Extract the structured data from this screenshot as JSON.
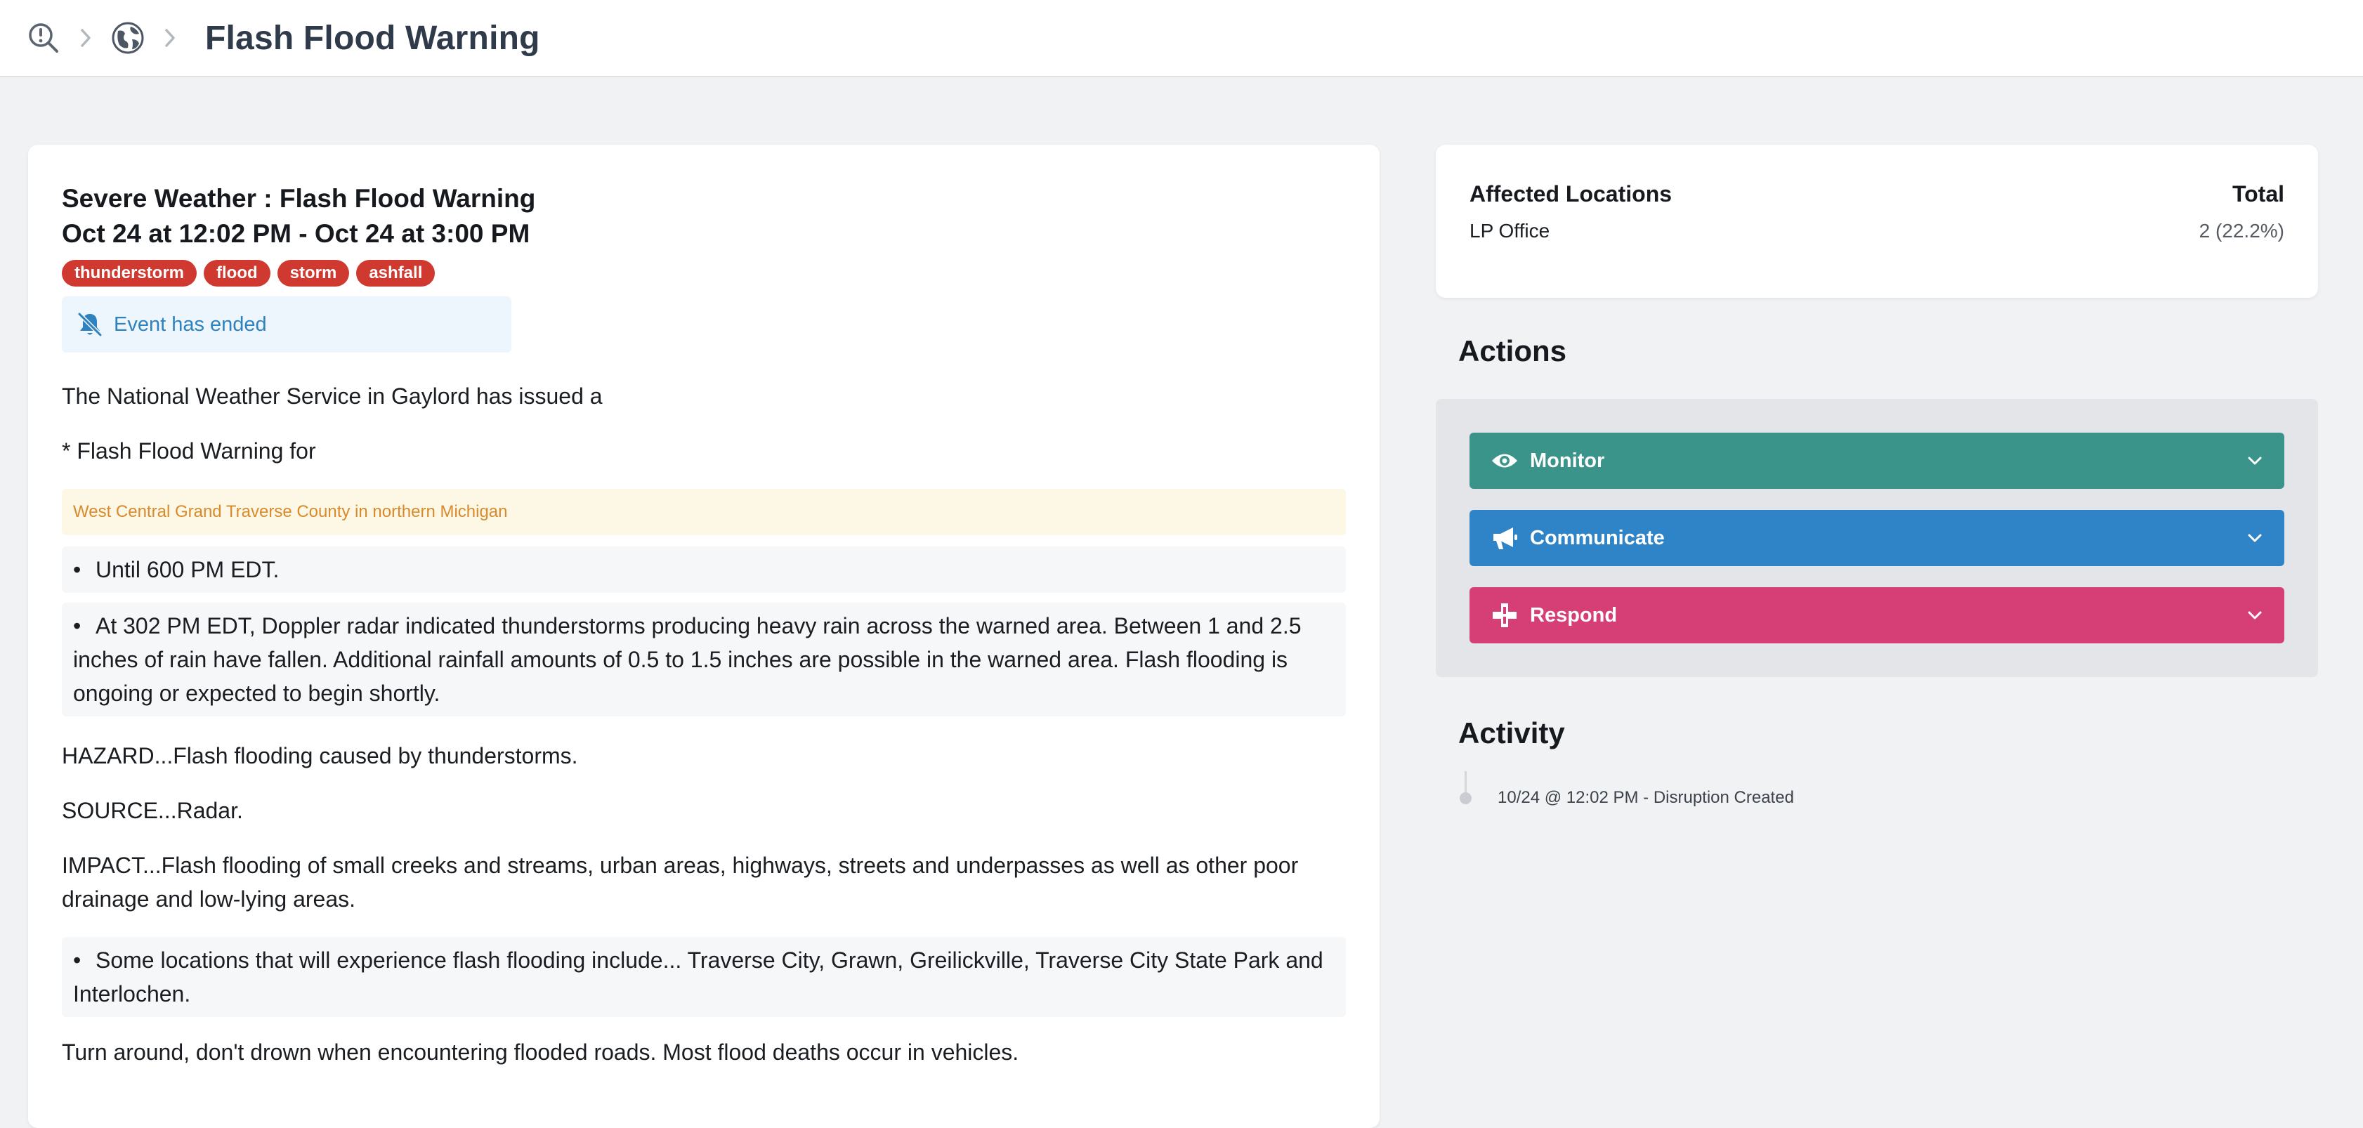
{
  "header": {
    "breadcrumb_icons": [
      "alert-search-icon",
      "globe-icon"
    ],
    "title": "Flash Flood Warning"
  },
  "event": {
    "heading": "Severe Weather : Flash Flood Warning",
    "timeframe": "Oct 24 at 12:02 PM - Oct 24 at 3:00 PM",
    "tags": [
      "thunderstorm",
      "flood",
      "storm",
      "ashfall"
    ],
    "tag_color": "#d0392f",
    "status": "Event has ended",
    "intro": "The National Weather Service in Gaylord has issued a",
    "warning_for": "* Flash Flood Warning for",
    "area": "West Central Grand Traverse County in northern Michigan",
    "bullet_until": "Until 600 PM EDT.",
    "bullet_radar": "At 302 PM EDT, Doppler radar indicated thunderstorms producing heavy rain across the warned area. Between 1 and 2.5 inches of rain have fallen. Additional rainfall amounts of 0.5 to 1.5 inches are possible in the warned area. Flash flooding is ongoing or expected to begin shortly.",
    "hazard": "HAZARD...Flash flooding caused by thunderstorms.",
    "source": "SOURCE...Radar.",
    "impact": "IMPACT...Flash flooding of small creeks and streams, urban areas, highways, streets and underpasses as well as other poor drainage and low-lying areas.",
    "bullet_locations": "Some locations that will experience flash flooding include... Traverse City, Grawn, Greilickville, Traverse City State Park and Interlochen.",
    "closing": "Turn around, don't drown when encountering flooded roads. Most flood deaths occur in vehicles."
  },
  "affected": {
    "header_locations": "Affected Locations",
    "header_total": "Total",
    "rows": [
      {
        "location": "LP Office",
        "total": "2 (22.2%)"
      }
    ]
  },
  "actions": {
    "title": "Actions",
    "buttons": [
      {
        "label": "Monitor",
        "color": "#3a948a",
        "icon": "eye-icon"
      },
      {
        "label": "Communicate",
        "color": "#2f84c8",
        "icon": "megaphone-icon"
      },
      {
        "label": "Respond",
        "color": "#d63e76",
        "icon": "medical-cross-icon"
      }
    ]
  },
  "activity": {
    "title": "Activity",
    "items": [
      {
        "text": "10/24 @ 12:02 PM - Disruption Created"
      }
    ]
  }
}
